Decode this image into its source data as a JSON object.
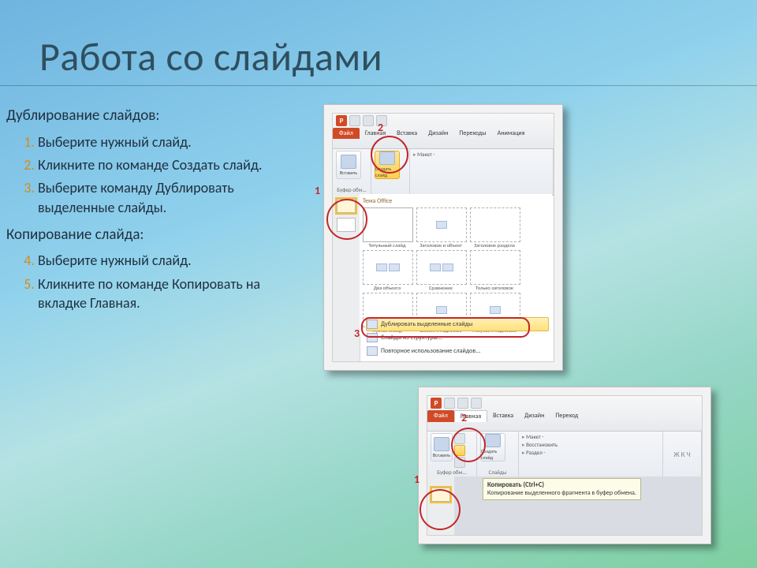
{
  "title": "Работа со слайдами",
  "sect1": "Дублирование слайдов:",
  "list1": [
    "Выберите нужный слайд.",
    "Кликните по команде Создать слайд.",
    "Выберите команду Дублировать выделенные слайды."
  ],
  "sect2": "Копирование слайда:",
  "list2": [
    "Выберите нужный слайд.",
    "Кликните по команде Копировать на вкладке Главная."
  ],
  "card1": {
    "tabs": [
      "Файл",
      "Главная",
      "Вставка",
      "Дизайн",
      "Переходы",
      "Анимация"
    ],
    "group_clip": "Буфер обм...",
    "btn_paste": "Вставить",
    "btn_new": "Создать слайд",
    "side_opts": [
      "Макет -",
      "",
      ""
    ],
    "gallery_title": "Тема Office",
    "layouts_r1": [
      "Титульный слайд",
      "Заголовок и объект",
      "Заголовок раздела"
    ],
    "layouts_r2": [
      "Два объекта",
      "Сравнение",
      "Только заголовок"
    ],
    "layouts_r3": [
      "Пустой слайд",
      "Объект с подписью",
      "Рисунок с подписью"
    ],
    "menu_dup": "Дублировать выделенные слайды",
    "menu_struct": "Слайды из структуры...",
    "menu_reuse": "Повторное использование слайдов...",
    "badges": {
      "b1": "1",
      "b2": "2",
      "b3": "3"
    }
  },
  "card2": {
    "tabs": [
      "Файл",
      "Главная",
      "Вставка",
      "Дизайн",
      "Переход"
    ],
    "group_clip": "Буфер обм...",
    "group_slides": "Слайды",
    "btn_paste": "Вставить",
    "btn_new": "Создать слайд",
    "side_opts": [
      "Макет -",
      "Восстановить",
      "Раздел -"
    ],
    "tooltip_title": "Копировать (Ctrl+C)",
    "tooltip_body": "Копирование выделенного фрагмента в буфер обмена.",
    "badges": {
      "b1": "1",
      "b2": "2"
    }
  }
}
